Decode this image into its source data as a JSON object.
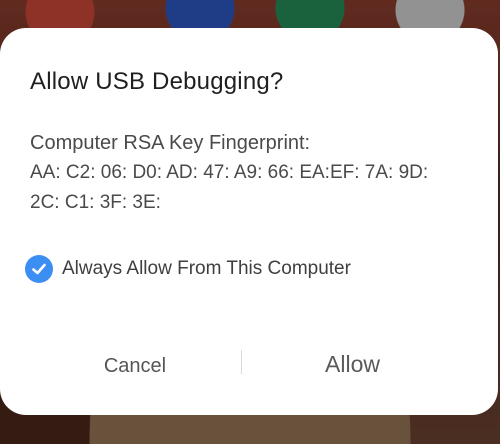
{
  "dialog": {
    "title": "Allow USB Debugging?",
    "fingerprint_heading": "Computer RSA Key Fingerprint:",
    "fingerprint_line1": "AA: C2: 06: D0: AD: 47: A9: 66: EA:EF: 7A: 9D:",
    "fingerprint_line2": "2C: C1: 3F: 3E:",
    "always_allow_label": "Always Allow From This Computer",
    "always_allow_checked": true,
    "cancel_label": "Cancel",
    "allow_label": "Allow"
  },
  "colors": {
    "accent": "#3d8ef2",
    "dialog_bg": "#ffffff"
  },
  "icons": {
    "checkbox": "checkmark-icon"
  }
}
